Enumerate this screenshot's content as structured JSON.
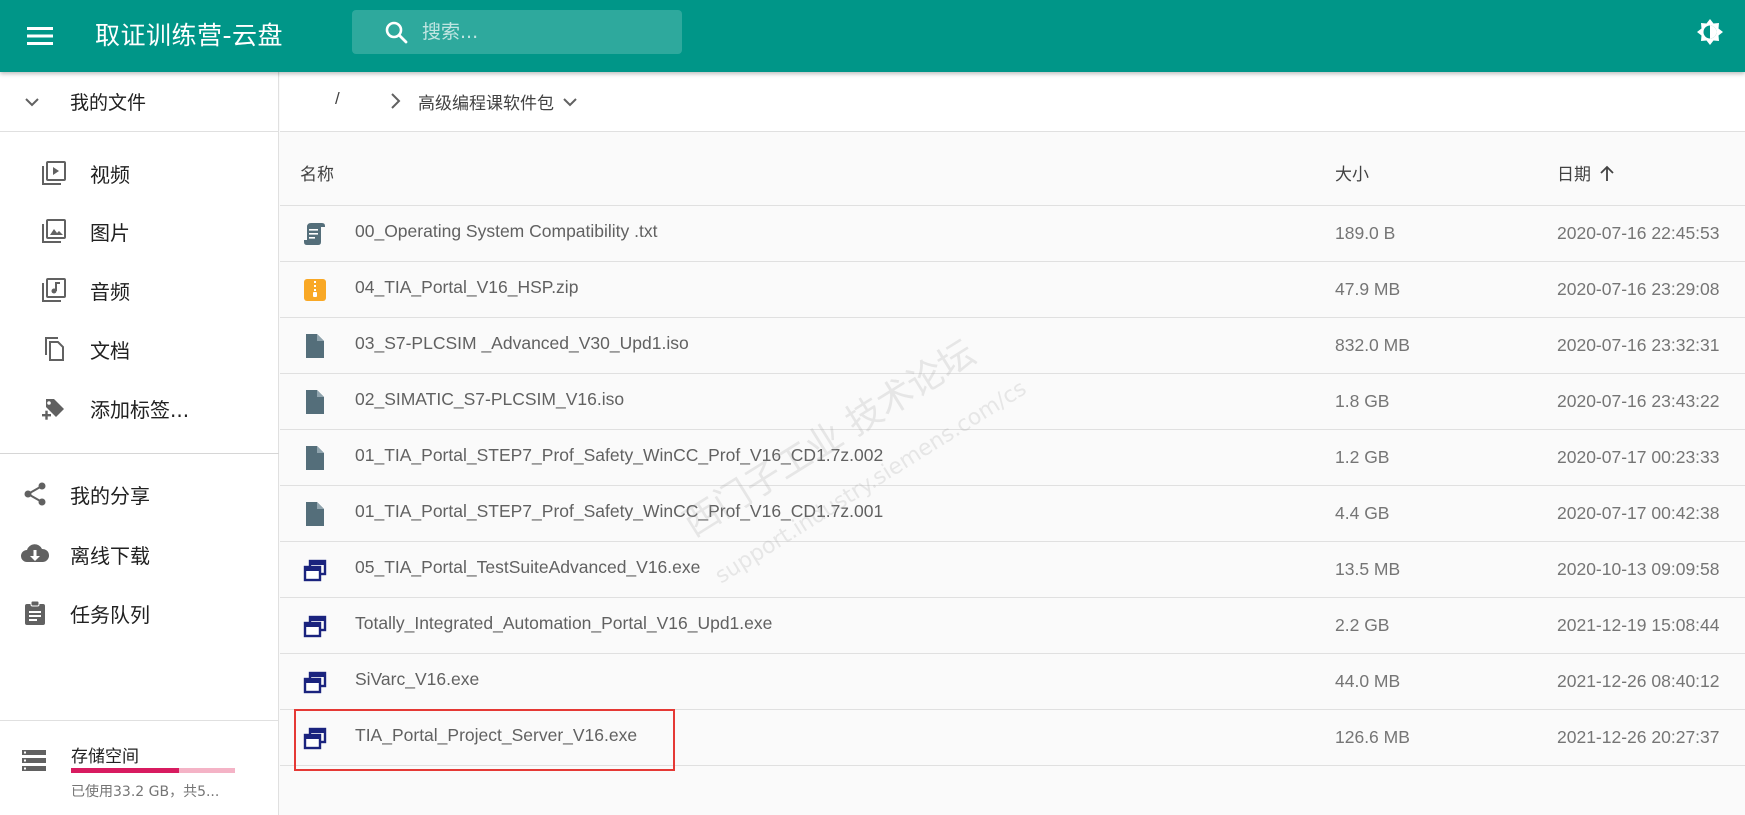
{
  "header": {
    "title": "取证训练营-云盘",
    "search_placeholder": "搜索...",
    "menu_icon": "menu-icon",
    "theme_icon": "brightness-icon",
    "color": "#009688"
  },
  "sidebar": {
    "my_files_label": "我的文件",
    "sub_items": [
      {
        "label": "视频",
        "icon": "video-library-icon"
      },
      {
        "label": "图片",
        "icon": "photo-library-icon"
      },
      {
        "label": "音频",
        "icon": "library-music-icon"
      },
      {
        "label": "文档",
        "icon": "file-copy-icon"
      },
      {
        "label": "添加标签...",
        "icon": "tag-plus-icon"
      }
    ],
    "main_items": [
      {
        "label": "我的分享",
        "icon": "share-icon"
      },
      {
        "label": "离线下载",
        "icon": "cloud-download-icon"
      },
      {
        "label": "任务队列",
        "icon": "assignment-icon"
      }
    ],
    "storage": {
      "title": "存储空间",
      "usage": "已使用33.2 GB，共5...",
      "used_fraction": 0.66,
      "bar_color": "#d81b60"
    }
  },
  "breadcrumb": {
    "root": "/",
    "folder": "高级编程课软件包"
  },
  "table": {
    "headers": {
      "name": "名称",
      "size": "大小",
      "date": "日期"
    },
    "sort": "date-ascending",
    "rows": [
      {
        "name": "00_Operating System Compatibility .txt",
        "size": "189.0 B",
        "date": "2020-07-16 22:45:53",
        "icon": "text-file-icon"
      },
      {
        "name": "04_TIA_Portal_V16_HSP.zip",
        "size": "47.9 MB",
        "date": "2020-07-16 23:29:08",
        "icon": "zip-file-icon"
      },
      {
        "name": "03_S7-PLCSIM _Advanced_V30_Upd1.iso",
        "size": "832.0 MB",
        "date": "2020-07-16 23:32:31",
        "icon": "file-icon"
      },
      {
        "name": "02_SIMATIC_S7-PLCSIM_V16.iso",
        "size": "1.8 GB",
        "date": "2020-07-16 23:43:22",
        "icon": "file-icon"
      },
      {
        "name": "01_TIA_Portal_STEP7_Prof_Safety_WinCC_Prof_V16_CD1.7z.002",
        "size": "1.2 GB",
        "date": "2020-07-17 00:23:33",
        "icon": "file-icon"
      },
      {
        "name": "01_TIA_Portal_STEP7_Prof_Safety_WinCC_Prof_V16_CD1.7z.001",
        "size": "4.4 GB",
        "date": "2020-07-17 00:42:38",
        "icon": "file-icon"
      },
      {
        "name": "05_TIA_Portal_TestSuiteAdvanced_V16.exe",
        "size": "13.5 MB",
        "date": "2020-10-13 09:09:58",
        "icon": "exe-file-icon"
      },
      {
        "name": "Totally_Integrated_Automation_Portal_V16_Upd1.exe",
        "size": "2.2 GB",
        "date": "2021-12-19 15:08:44",
        "icon": "exe-file-icon"
      },
      {
        "name": "SiVarc_V16.exe",
        "size": "44.0 MB",
        "date": "2021-12-26 08:40:12",
        "icon": "exe-file-icon"
      },
      {
        "name": "TIA_Portal_Project_Server_V16.exe",
        "size": "126.6 MB",
        "date": "2021-12-26 20:27:37",
        "icon": "exe-file-icon"
      }
    ]
  },
  "watermark": {
    "line1": "西门子工业  技术论坛",
    "line2": "support.industry.siemens.com/cs"
  }
}
